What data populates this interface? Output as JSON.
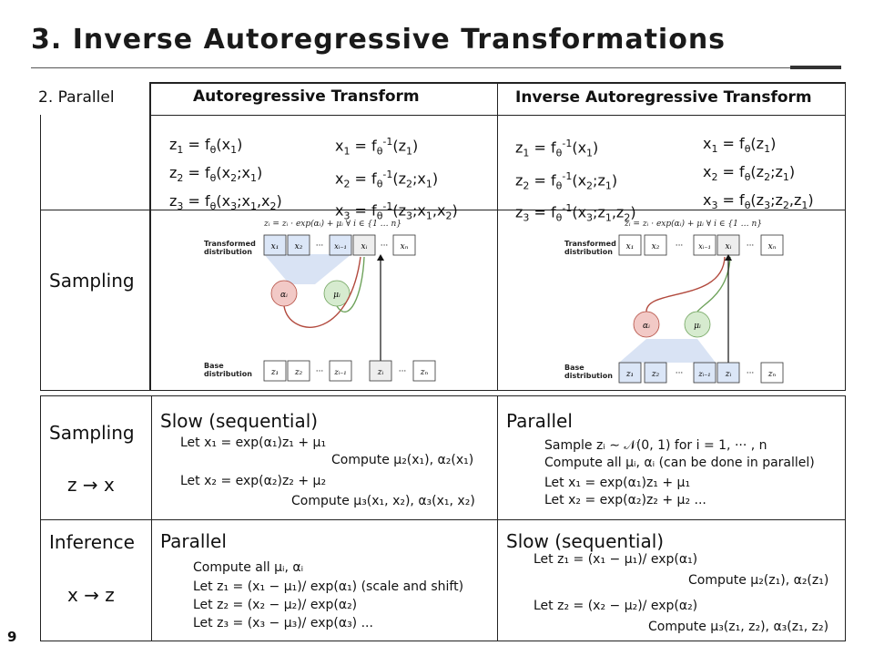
{
  "title": "3. Inverse Autoregressive Transformations",
  "page_number": "9",
  "table": {
    "corner_label": "2. Parallel",
    "col1_header": "Autoregressive Transform",
    "col2_header": "Inverse Autoregressive Transform",
    "ar_forward": [
      "z₁ = fθ(x₁)",
      "z₂ = fθ(x₂;x₁)",
      "z₃ = fθ(x₃;x₁,x₂)"
    ],
    "ar_inverse": [
      "x₁ = fθ⁻¹(z₁)",
      "x₂ = fθ⁻¹(z₂;x₁)",
      "x₃ = fθ⁻¹(z₃;x₁,x₂)"
    ],
    "iaf_forward": [
      "z₁ = fθ⁻¹(x₁)",
      "z₂ = fθ⁻¹(x₂;z₁)",
      "z₃ = fθ⁻¹(x₃;z₁,z₂)"
    ],
    "iaf_inverse": [
      "x₁ = fθ(z₁)",
      "x₂ = fθ(z₂;z₁)",
      "x₃ = fθ(z₃;z₂,z₁)"
    ],
    "sampling_row_label": "Sampling",
    "diagram": {
      "equation": "zᵢ = zᵢ · exp(αᵢ) + μᵢ  ∀ i ∈ {1 … n}",
      "transformed_label_1": "Transformed",
      "transformed_label_2": "distribution",
      "base_label_1": "Base",
      "base_label_2": "distribution",
      "top_cells_ar": [
        "x₁",
        "x₂",
        "···",
        "xᵢ₋₁",
        "xᵢ",
        "···",
        "xₙ"
      ],
      "top_cells_iaf": [
        "x₁",
        "x₂",
        "···",
        "xᵢ₋₁",
        "xᵢ",
        "···",
        "xₙ"
      ],
      "bottom_cells": [
        "z₁",
        "z₂",
        "···",
        "zᵢ₋₁",
        "zᵢ",
        "···",
        "zₙ"
      ],
      "alpha": "αᵢ",
      "mu": "μᵢ"
    },
    "sampling2_label": "Sampling",
    "sampling2_sub": "z → x",
    "inference_label": "Inference",
    "inference_sub": "x → z",
    "ar_sampling_speed": "Slow (sequential)",
    "iaf_sampling_speed": "Parallel",
    "ar_inference_speed": "Parallel",
    "iaf_inference_speed": "Slow (sequential)",
    "ar_sampling_math": [
      "Let x₁ = exp(α₁)z₁ + μ₁",
      "Compute μ₂(x₁), α₂(x₁)",
      "Let x₂ = exp(α₂)z₂ + μ₂",
      "Compute μ₃(x₁, x₂), α₃(x₁, x₂)"
    ],
    "iaf_sampling_math": [
      "Sample zᵢ ∼ 𝒩(0, 1) for i = 1, ··· , n",
      "Compute all μᵢ, αᵢ (can be done in parallel)",
      "Let x₁ = exp(α₁)z₁ + μ₁",
      "Let x₂ = exp(α₂)z₂ + μ₂ ..."
    ],
    "ar_inference_math": [
      "Compute all μᵢ, αᵢ",
      "Let z₁ = (x₁ − μ₁)/ exp(α₁) (scale and shift)",
      "Let z₂ = (x₂ − μ₂)/ exp(α₂)",
      "Let z₃ = (x₃ − μ₃)/ exp(α₃) ..."
    ],
    "iaf_inference_math": [
      "Let z₁ = (x₁ − μ₁)/ exp(α₁)",
      "Compute μ₂(z₁), α₂(z₁)",
      "Let z₂ = (x₂ − μ₂)/ exp(α₂)",
      "Compute μ₃(z₁, z₂), α₃(z₁, z₂)"
    ]
  },
  "colors": {
    "cell_fill": "#dbe6f7",
    "alpha_fill": "#f2c9c6",
    "mu_fill": "#d6ebcf",
    "fan_fill": "#c9d7ef",
    "arrow_red": "#b24a3e",
    "arrow_green": "#6fa35c"
  }
}
